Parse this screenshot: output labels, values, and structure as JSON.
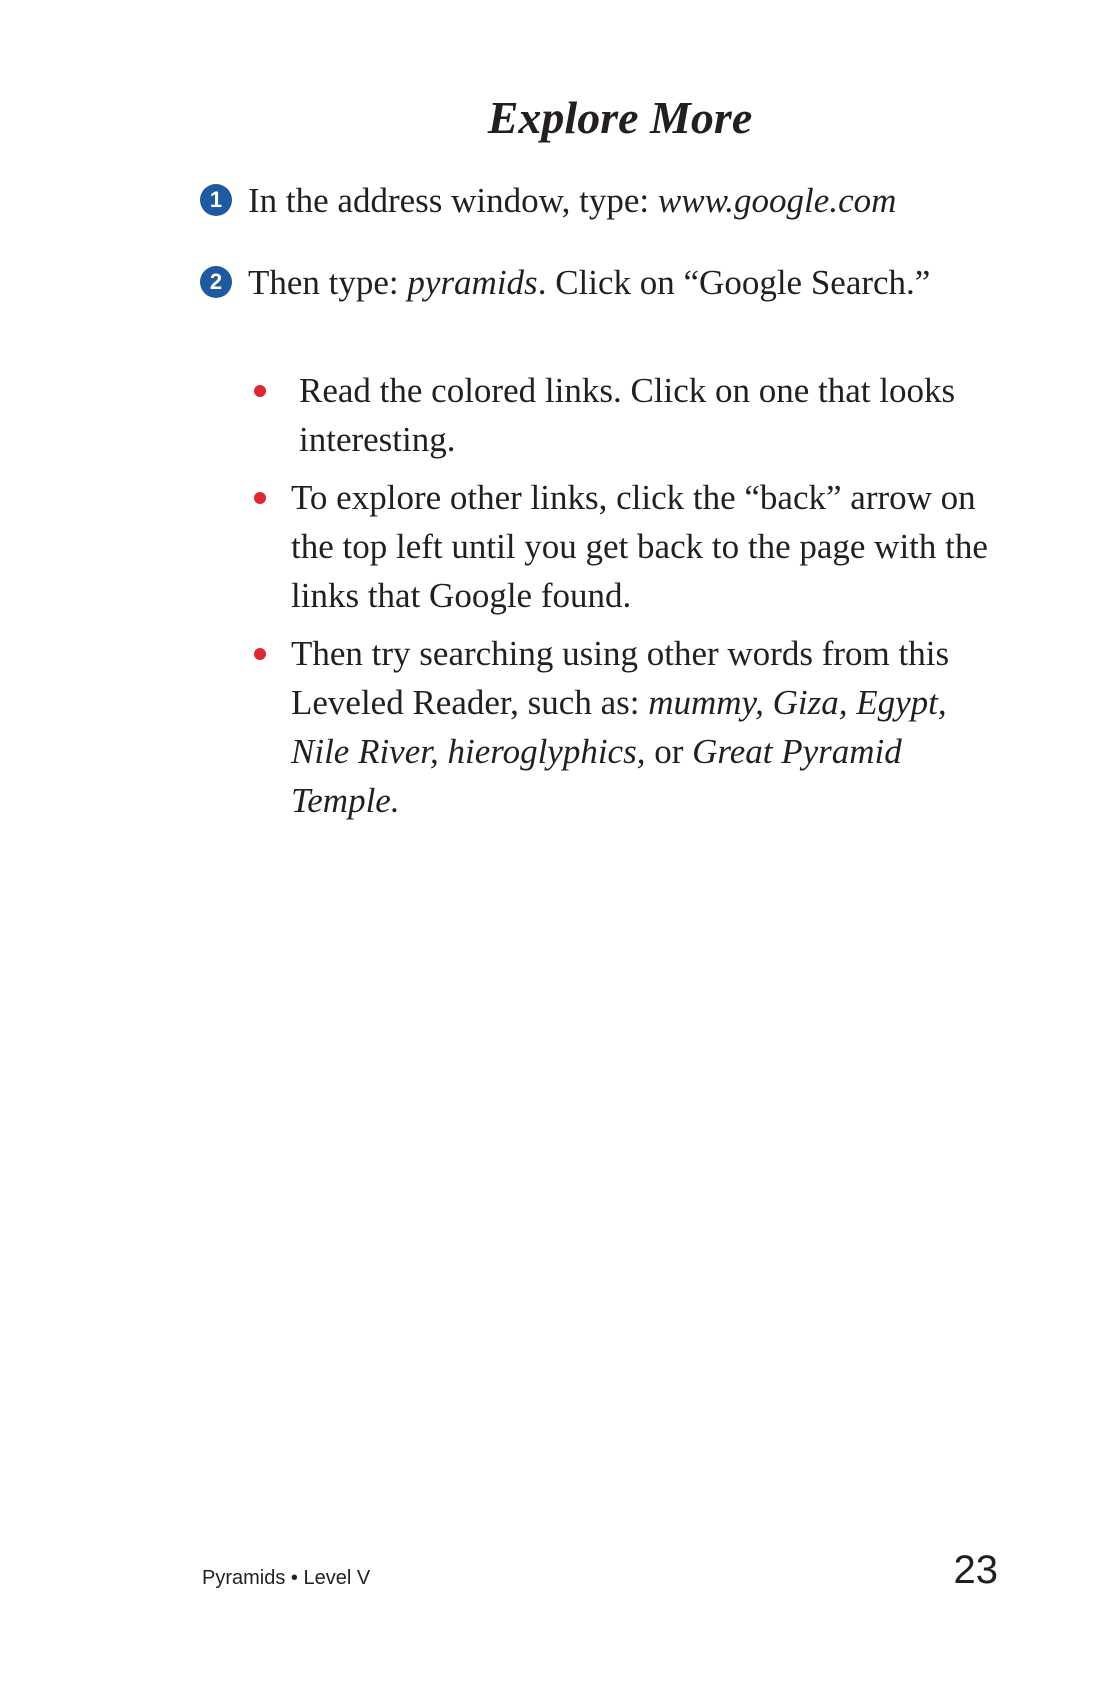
{
  "title": "Explore More",
  "steps": [
    {
      "number": "1",
      "text": "In the address window, type: ",
      "italic": "www.google.com"
    },
    {
      "number": "2",
      "text_before": "Then type: ",
      "italic": "pyramids",
      "text_after": ". Click on “Google Search.”"
    }
  ],
  "bullets": [
    {
      "text": "Read the colored links. Click on one that looks interesting."
    },
    {
      "text": "To explore other links, click the “back” arrow on the top left until you get back to the page with the links that Google found."
    },
    {
      "text_before": "Then try searching using other words from this Leveled Reader, such as: ",
      "italic_1": "mummy, Giza, Egypt, Nile River, hieroglyphics,",
      "text_middle": " or ",
      "italic_2": "Great Pyramid Temple."
    }
  ],
  "footer": {
    "label": "Pyramids • Level V",
    "page_number": "23"
  },
  "colors": {
    "step_marker": "#1f5aa0",
    "bullet": "#e0262f",
    "text": "#231f20"
  }
}
